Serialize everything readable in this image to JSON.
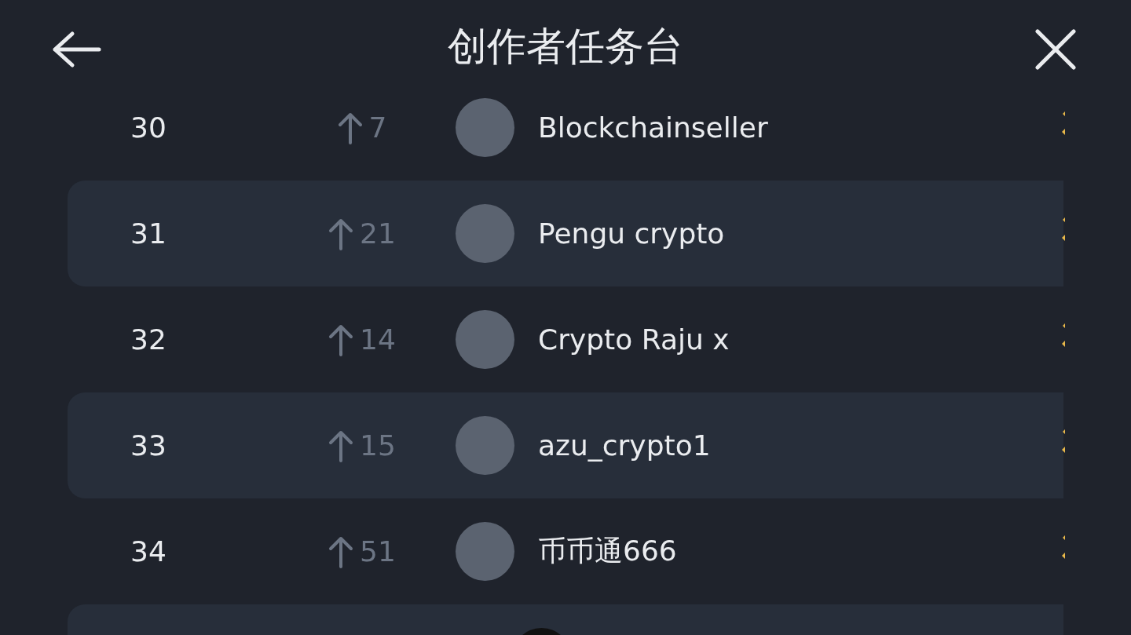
{
  "header": {
    "title": "创作者任务台"
  },
  "rows": [
    {
      "rank": "30",
      "kind": "up",
      "change": "7",
      "name": "Blockchainseller"
    },
    {
      "rank": "31",
      "kind": "up",
      "change": "21",
      "name": "Pengu crypto"
    },
    {
      "rank": "32",
      "kind": "up",
      "change": "14",
      "name": "Crypto Raju x"
    },
    {
      "rank": "33",
      "kind": "up",
      "change": "15",
      "name": "azu_crypto1"
    },
    {
      "rank": "34",
      "kind": "up",
      "change": "51",
      "name": "币币通666"
    }
  ],
  "more_rows_below": true
}
